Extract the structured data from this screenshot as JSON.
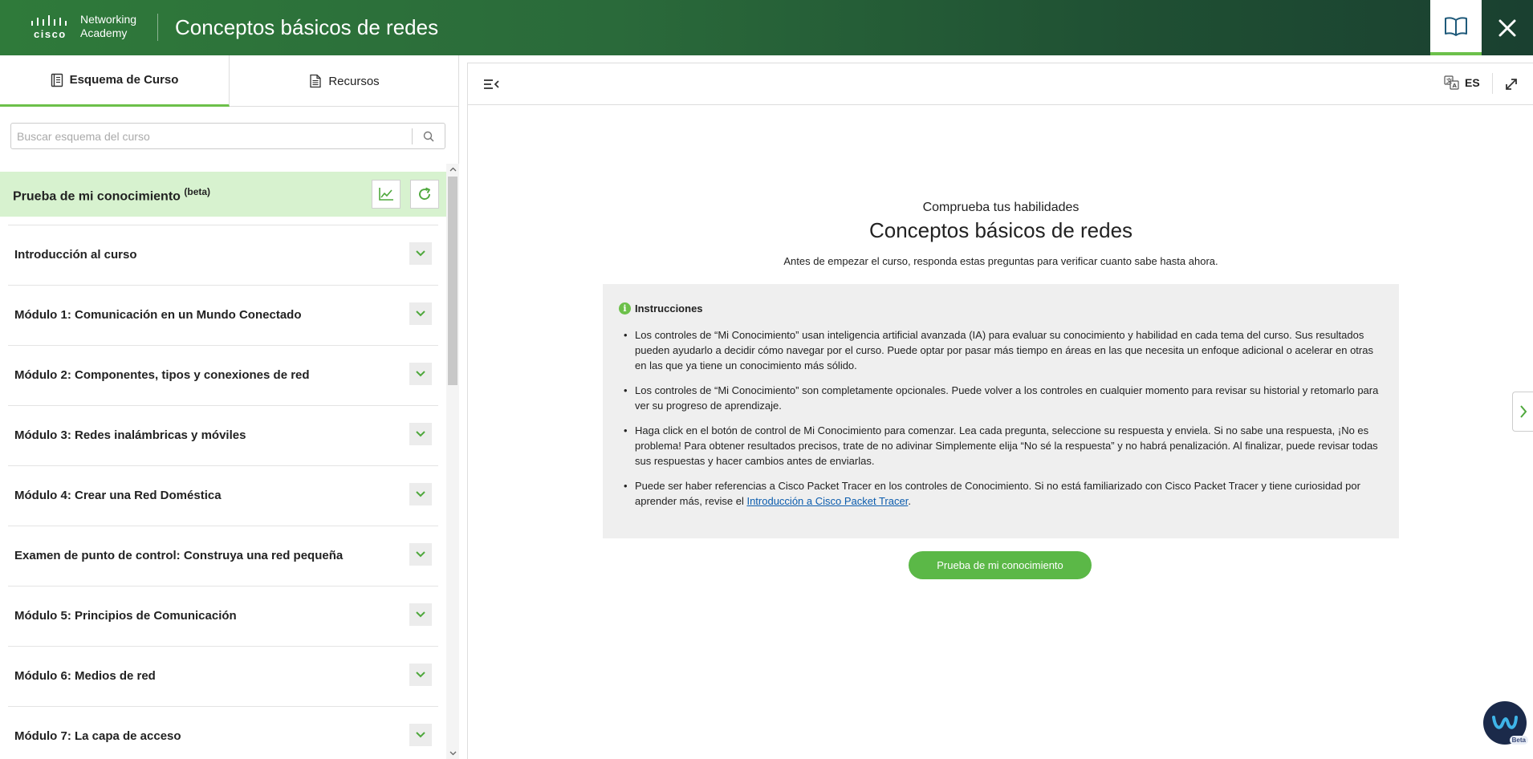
{
  "header": {
    "logo_brand": "cisco",
    "logo_line1": "Networking",
    "logo_line2": "Academy",
    "title": "Conceptos básicos de redes"
  },
  "sidebar": {
    "tabs": [
      {
        "label": "Esquema de Curso",
        "active": true,
        "icon": "outline-icon"
      },
      {
        "label": "Recursos",
        "active": false,
        "icon": "document-icon"
      }
    ],
    "search": {
      "placeholder": "Buscar esquema del curso",
      "value": ""
    },
    "knowledge": {
      "label": "Prueba de mi conocimiento",
      "badge": "(beta)"
    },
    "items": [
      {
        "label": "Introducción al curso"
      },
      {
        "label": "Módulo 1: Comunicación en un Mundo Conectado"
      },
      {
        "label": "Módulo 2: Componentes, tipos y conexiones de red"
      },
      {
        "label": "Módulo 3: Redes inalámbricas y móviles"
      },
      {
        "label": "Módulo 4: Crear una Red Doméstica"
      },
      {
        "label": "Examen de punto de control: Construya una red pequeña"
      },
      {
        "label": "Módulo 5: Principios de Comunicación"
      },
      {
        "label": "Módulo 6: Medios de red"
      },
      {
        "label": "Módulo 7: La capa de acceso"
      }
    ]
  },
  "toolbar": {
    "language": "ES"
  },
  "main": {
    "subtitle": "Comprueba tus habilidades",
    "title": "Conceptos básicos de redes",
    "lead": "Antes de empezar el curso, responda estas preguntas para verificar cuanto sabe hasta ahora.",
    "instructions_heading": "Instrucciones",
    "instructions": [
      "Los controles de “Mi Conocimiento” usan inteligencia artificial avanzada (IA) para evaluar su conocimiento y habilidad en cada tema del curso. Sus resultados pueden ayudarlo a decidir cómo navegar por el curso. Puede optar por pasar más tiempo en áreas en las que necesita un enfoque adicional o acelerar en otras en las que ya tiene un conocimiento más sólido.",
      "Los controles de “Mi Conocimiento” son completamente opcionales. Puede volver a los controles en cualquier momento para revisar su historial y retomarlo para ver su progreso de aprendizaje.",
      "Haga click en el botón de control de Mi Conocimiento para comenzar. Lea cada pregunta, seleccione su respuesta y enviela. Si no sabe una respuesta, ¡No es problema! Para obtener resultados precisos, trate de no adivinar Simplemente elija “No sé la respuesta” y no habrá penalización. Al finalizar, puede revisar todas sus respuestas y hacer cambios antes de enviarlas."
    ],
    "instruction_last_prefix": "Puede ser haber referencias a Cisco Packet Tracer en los controles de Conocimiento. Si no está familiarizado con Cisco Packet Tracer y tiene curiosidad por aprender más, revise el ",
    "instruction_last_link": "Introducción a Cisco Packet Tracer",
    "instruction_last_suffix": ".",
    "start_button": "Prueba de mi conocimiento"
  },
  "webex_badge": "Beta",
  "colors": {
    "brand_green": "#6cc04a",
    "header_dark": "#1f4f33",
    "knowledge_bg": "#d7f2cf",
    "link": "#0b5cad"
  }
}
